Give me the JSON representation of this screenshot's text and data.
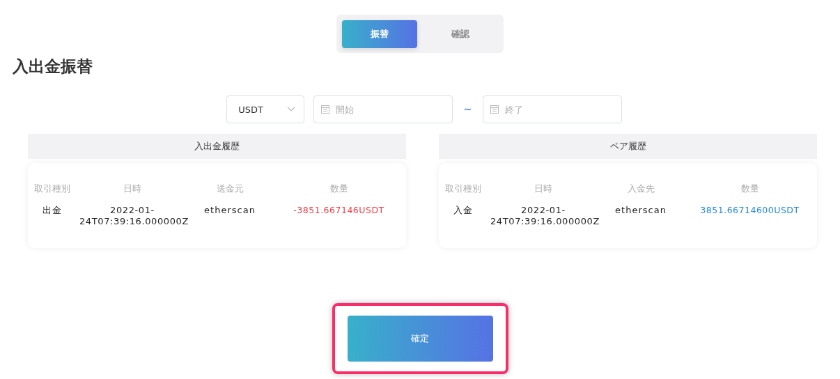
{
  "tabs": [
    {
      "label": "振替",
      "selected": true
    },
    {
      "label": "確認",
      "selected": false
    }
  ],
  "title": "入出金振替",
  "filters": {
    "currency": "USDT",
    "start": {
      "placeholder": "開始"
    },
    "separator": "~",
    "end": {
      "placeholder": "終了"
    }
  },
  "panels": [
    {
      "title": "入出金履歴",
      "columns": [
        "取引種別",
        "日時",
        "送金元",
        "数量"
      ],
      "rows": [
        {
          "type": "出金",
          "datetime": "2022-01-24T07:39:16.000000Z",
          "party": "etherscan",
          "amount": "-3851.667146USDT",
          "kind": "negative"
        }
      ]
    },
    {
      "title": "ペア履歴",
      "columns": [
        "取引種別",
        "日時",
        "入金先",
        "数量"
      ],
      "rows": [
        {
          "type": "入金",
          "datetime": "2022-01-24T07:39:16.000000Z",
          "party": "etherscan",
          "amount": "3851.66714600USDT",
          "kind": "positive"
        }
      ]
    }
  ],
  "confirm": {
    "label": "確定",
    "highlighted": true
  }
}
